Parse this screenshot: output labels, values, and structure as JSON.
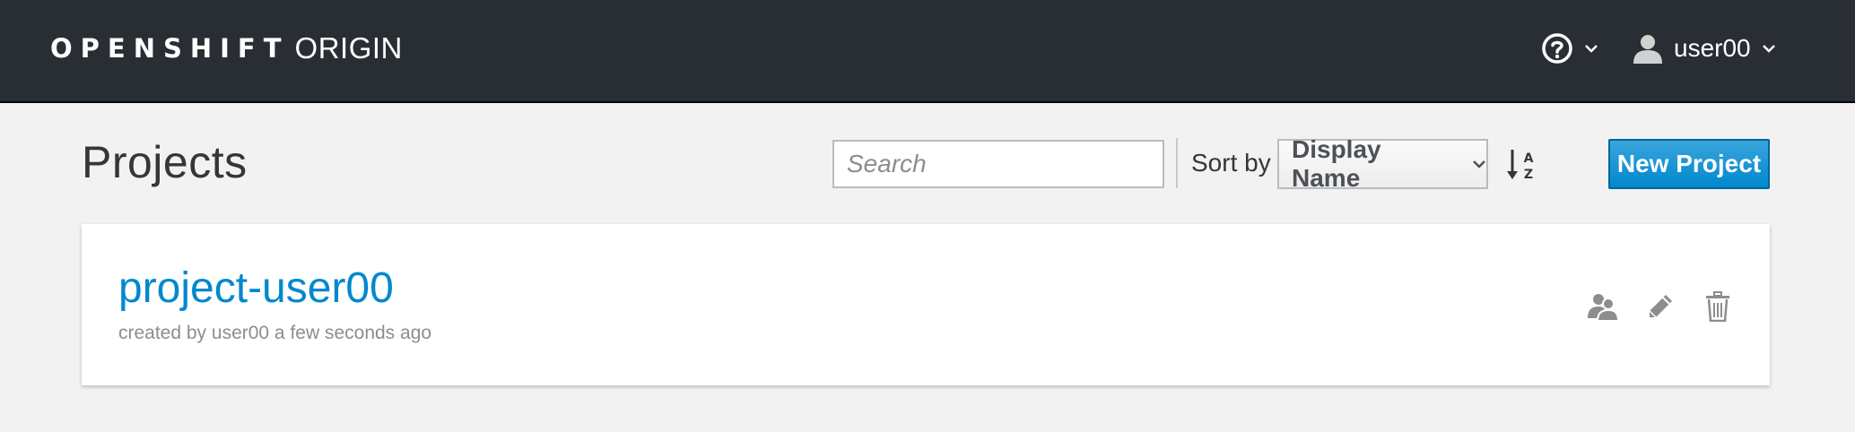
{
  "navbar": {
    "brand_bold": "OPENSHIFT",
    "brand_light": "ORIGIN",
    "help_icon": "question-circle-icon",
    "user_icon": "user-icon",
    "username": "user00"
  },
  "page": {
    "title": "Projects"
  },
  "toolbar": {
    "search_placeholder": "Search",
    "search_value": "",
    "sort_label": "Sort by",
    "sort_selected": "Display Name",
    "sort_direction_icon": "sort-alpha-asc-icon",
    "new_project_label": "New Project"
  },
  "projects": [
    {
      "name": "project-user00",
      "meta": "created by user00 a few seconds ago",
      "action_icons": [
        "view-membership-icon",
        "edit-pencil-icon",
        "delete-trash-icon"
      ]
    }
  ],
  "colors": {
    "navbar_bg": "#292e34",
    "page_bg": "#f2f2f2",
    "primary": "#0088ce",
    "link": "#0088ce",
    "muted_text": "#8b8d8f",
    "action_icon": "#8b8d8f"
  }
}
